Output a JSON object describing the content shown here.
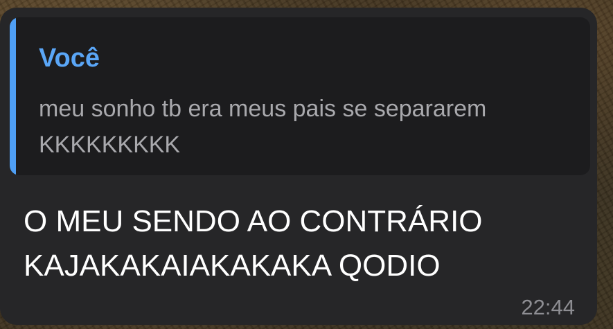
{
  "reply": {
    "author": "Você",
    "text": "meu sonho tb era meus pais se separarem\nKKKKKKKKK"
  },
  "message": {
    "text": "O MEU SENDO AO CONTRÁRIO\nKAJAKAKAIAKAKAKA QODIO",
    "timestamp": "22:44"
  },
  "colors": {
    "bubble": "#262628",
    "reply_background": "#1c1c1e",
    "reply_accent": "#4f9ff5",
    "author_name": "#5aa6f7",
    "message_text": "#ffffff",
    "timestamp": "#8e8e93"
  }
}
